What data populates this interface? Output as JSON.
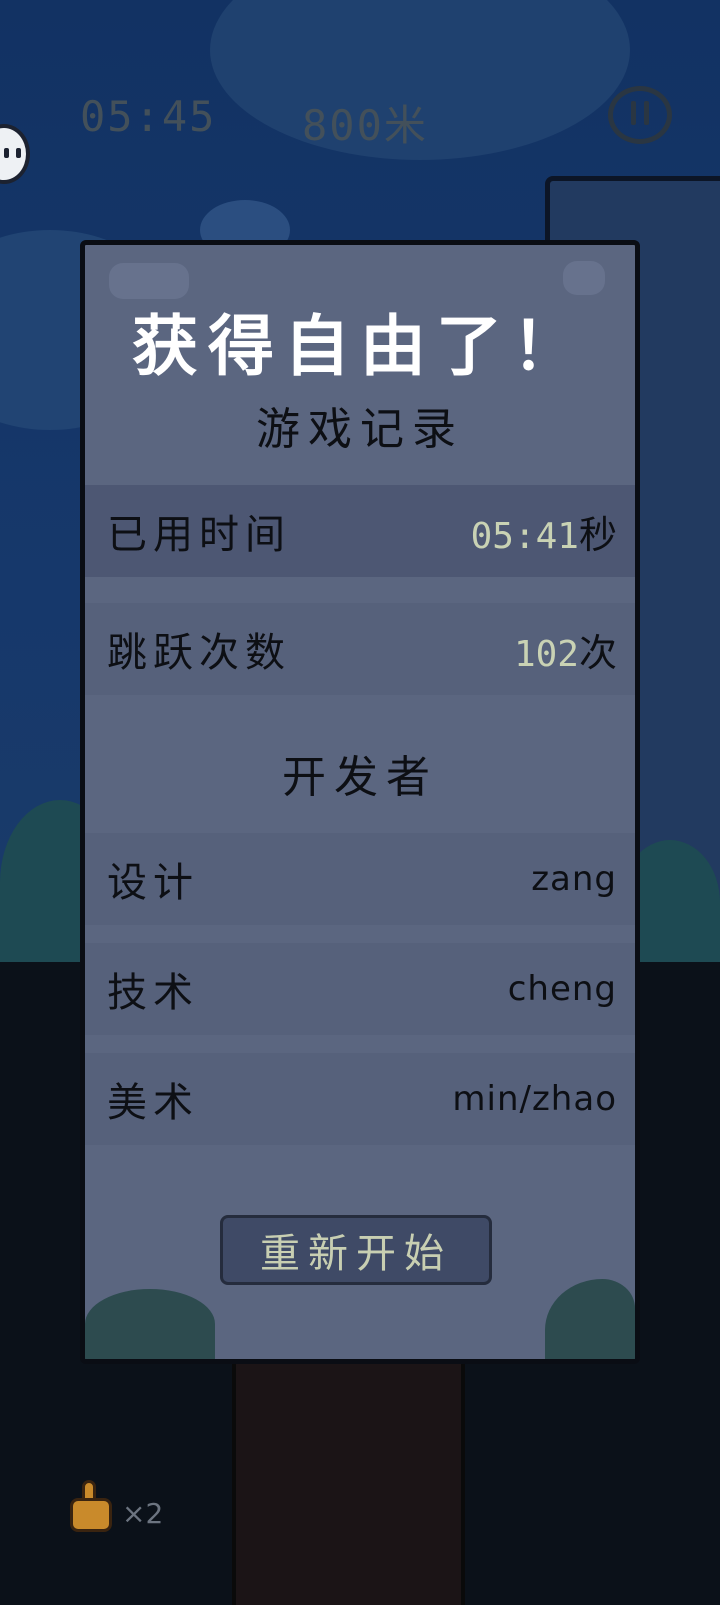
{
  "hud": {
    "time": "05:45",
    "distance": "800米"
  },
  "result_panel": {
    "title": "获得自由了！",
    "record_heading": "游戏记录",
    "stats": [
      {
        "label": "已用时间",
        "value": "05:41",
        "unit": "秒"
      },
      {
        "label": "跳跃次数",
        "value": "102",
        "unit": "次"
      }
    ],
    "developers_heading": "开发者",
    "developers": [
      {
        "role": "设计",
        "name": "zang"
      },
      {
        "role": "技术",
        "name": "cheng"
      },
      {
        "role": "美术",
        "name": "min/zhao"
      }
    ],
    "restart_label": "重新开始"
  },
  "lives": {
    "count_text": "×2"
  },
  "colors": {
    "panel_bg": "#5b6680",
    "row_dark": "#4d5773",
    "value_highlight": "#c9d2b4",
    "sky": "#123263"
  }
}
